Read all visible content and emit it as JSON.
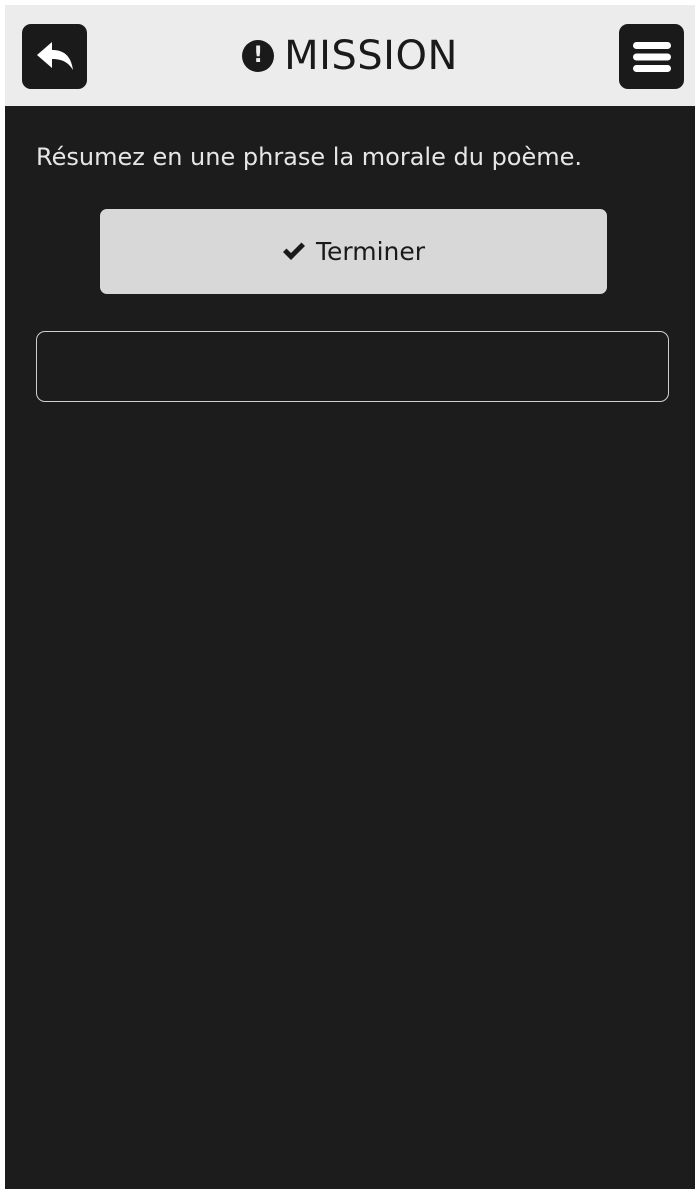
{
  "header": {
    "title": "MISSION",
    "title_icon": "exclamation-circle-icon",
    "back_icon": "reply-arrow-icon",
    "menu_icon": "hamburger-menu-icon"
  },
  "mission": {
    "prompt": "Résumez en une phrase la morale du poème.",
    "finish_label": "Terminer",
    "finish_icon": "checkmark-icon"
  },
  "answer": {
    "value": "",
    "placeholder": ""
  },
  "colors": {
    "background": "#1c1c1c",
    "header_background": "#ececec",
    "button_background": "#d8d8d8",
    "text_light": "#e6e6e6",
    "text_dark": "#1a1a1a"
  }
}
